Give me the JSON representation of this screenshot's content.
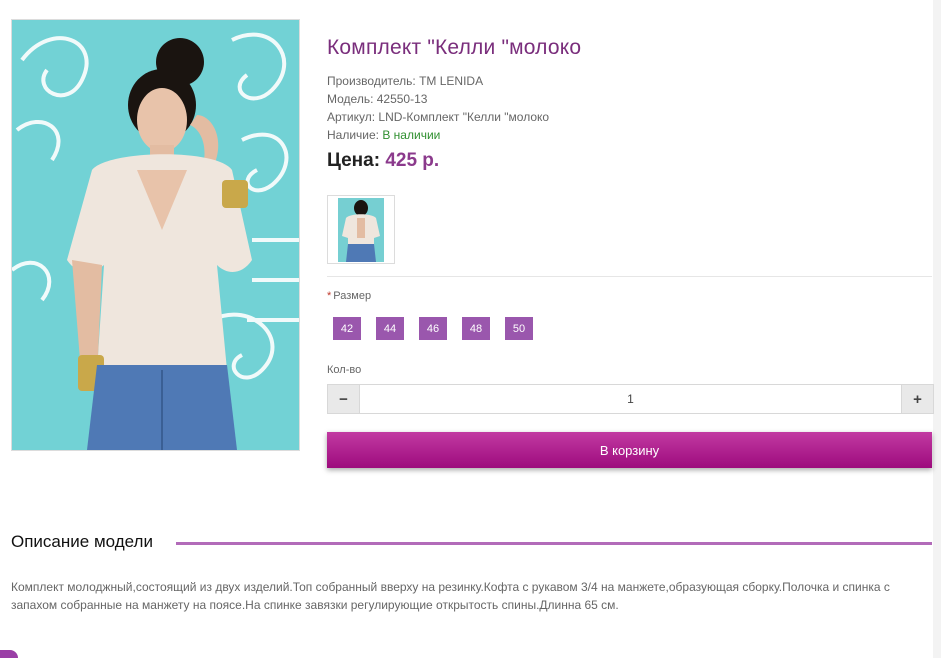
{
  "product": {
    "title": "Комплект \"Келли \"молоко",
    "manufacturer": "Производитель: TM LENIDA",
    "model": "Модель: 42550-13",
    "sku": "Артикул: LND-Комплект \"Келли \"молоко",
    "availability_label": "Наличие: ",
    "availability_value": "В наличии",
    "price_label": "Цена: ",
    "price_value": "425 р."
  },
  "options": {
    "size_required_mark": "*",
    "size_label": "Размер",
    "sizes": [
      "42",
      "44",
      "46",
      "48",
      "50"
    ]
  },
  "quantity": {
    "label": "Кол-во",
    "value": "1",
    "minus": "−",
    "plus": "+"
  },
  "cart_button": "В корзину",
  "description": {
    "heading": "Описание модели",
    "text": "Комплект молоджный,состоящий из двух изделий.Топ собранный вверху на резинку.Кофта с рукавом 3/4 на манжете,образующая сборку.Полочка и спинка с запахом собранные на манжету на поясе.На спинке завязки регулирующие открытость спины.Длинна 65 см."
  },
  "colors": {
    "accent": "#7a2e7c",
    "size_button": "#9a57ad",
    "cart_button": "#b1208f",
    "in_stock": "#2f8f2f"
  }
}
